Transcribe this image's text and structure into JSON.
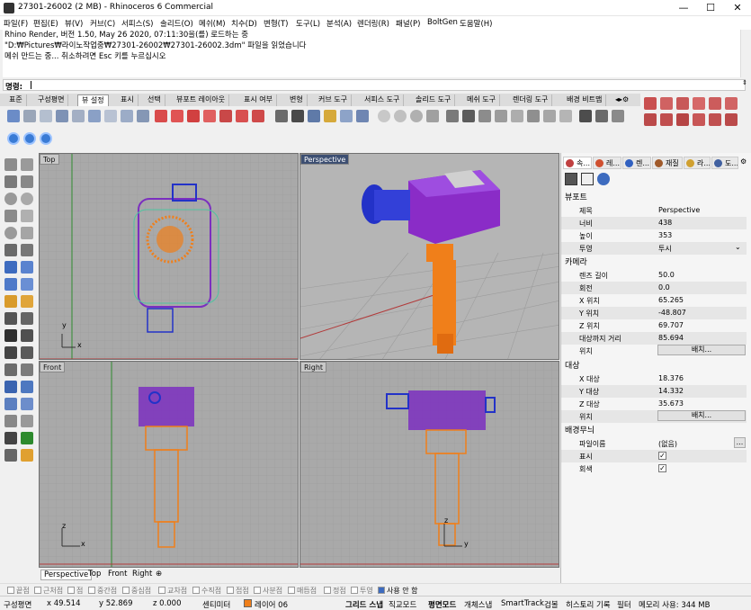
{
  "window": {
    "title": "27301-26002 (2 MB) - Rhinoceros 6 Commercial",
    "minimize": "—",
    "maximize": "☐",
    "close": "✕"
  },
  "menu": [
    "파일(F)",
    "편집(E)",
    "뷰(V)",
    "커브(C)",
    "서피스(S)",
    "솔리드(O)",
    "메쉬(M)",
    "치수(D)",
    "변형(T)",
    "도구(L)",
    "분석(A)",
    "렌더링(R)",
    "패널(P)",
    "BoltGen",
    "도움말(H)"
  ],
  "history": [
    "Rhino Render, 버전 1.50, May 26 2020, 07:11:30을(를) 로드하는 중",
    "\"D:₩Pictures₩라이노작업중₩27301-26002₩27301-26002.3dm\" 파일을 읽었습니다",
    "메쉬 만드는 중... 취소하려면 Esc 키를 누르십시오"
  ],
  "command": {
    "label": "명령:",
    "value": ""
  },
  "toolbar_tabs": [
    "표준",
    "구성평면",
    "뷰 설정",
    "표시",
    "선택",
    "뷰포트 레이아웃",
    "표시 여부",
    "변형",
    "커브 도구",
    "서피스 도구",
    "솔리드 도구",
    "메쉬 도구",
    "렌더링 도구",
    "배경 비트맵"
  ],
  "active_toolbar_tab": "뷰 설정",
  "viewports": {
    "top": {
      "title": "Top",
      "axis_x": "x",
      "axis_y": "y"
    },
    "perspective": {
      "title": "Perspective"
    },
    "front": {
      "title": "Front",
      "axis_x": "x",
      "axis_y": "z"
    },
    "right": {
      "title": "Right",
      "axis_x": "y",
      "axis_y": "z"
    }
  },
  "viewport_tabs": [
    "Perspective",
    "Top",
    "Front",
    "Right",
    "⊕"
  ],
  "snaps": [
    "끝점",
    "근처점",
    "점",
    "중간점",
    "중심점",
    "교차점",
    "수직점",
    "접점",
    "사분점",
    "매듭점",
    "정점",
    "투영"
  ],
  "snap_disable": "사용 안 함",
  "status": {
    "cplane": "구성평면",
    "x": "x 49.514",
    "y": "y 52.869",
    "z": "z 0.000",
    "units": "센티미터",
    "layer": "레이어 06",
    "layer_color": "#f07f1a",
    "grid_snap": "그리드 스냅",
    "ortho": "직교모드",
    "planar": "평면모드",
    "osnap": "개체스냅",
    "smarttrack": "SmartTrack",
    "gumball": "검볼",
    "history": "히스토리 기록",
    "filter": "필터",
    "memory": "메모리 사용: 344 MB"
  },
  "panel": {
    "tabs": [
      "속...",
      "레...",
      "렌...",
      "재질",
      "라...",
      "도..."
    ],
    "viewport_section": "뷰포트",
    "viewport_rows": [
      {
        "k": "제목",
        "v": "Perspective"
      },
      {
        "k": "너비",
        "v": "438"
      },
      {
        "k": "높이",
        "v": "353"
      },
      {
        "k": "투영",
        "v": "투시"
      }
    ],
    "camera_section": "카메라",
    "camera_rows": [
      {
        "k": "렌즈 길이",
        "v": "50.0"
      },
      {
        "k": "회전",
        "v": "0.0"
      },
      {
        "k": "X 위치",
        "v": "65.265"
      },
      {
        "k": "Y 위치",
        "v": "-48.807"
      },
      {
        "k": "Z 위치",
        "v": "69.707"
      },
      {
        "k": "대상까지 거리",
        "v": "85.694"
      }
    ],
    "location_label": "위치",
    "place_button": "배치...",
    "target_section": "대상",
    "target_rows": [
      {
        "k": "X 대상",
        "v": "18.376"
      },
      {
        "k": "Y 대상",
        "v": "14.332"
      },
      {
        "k": "Z 대상",
        "v": "35.673"
      }
    ],
    "wallpaper_section": "배경무늬",
    "file_label": "파일이름",
    "file_value": "(없음)",
    "file_btn": "...",
    "show_label": "표시",
    "gray_label": "회색"
  }
}
